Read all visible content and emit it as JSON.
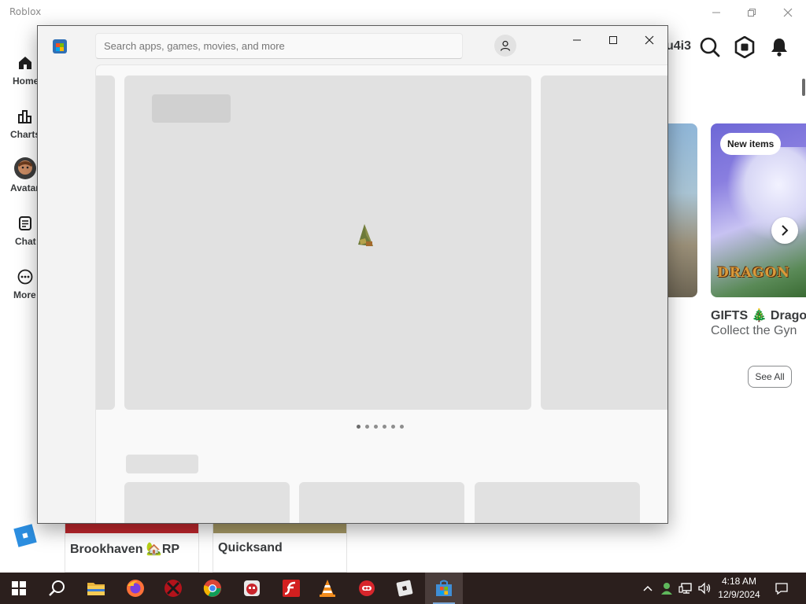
{
  "roblox": {
    "window_title": "Roblox",
    "nav": [
      {
        "label": "Home",
        "icon": "home-icon"
      },
      {
        "label": "Charts",
        "icon": "charts-icon"
      },
      {
        "label": "Avatar",
        "icon": "avatar-icon"
      },
      {
        "label": "Chat",
        "icon": "chat-icon"
      },
      {
        "label": "More",
        "icon": "more-icon"
      }
    ],
    "username_fragment": "u4i3",
    "header_icons": [
      "search-icon",
      "robux-icon",
      "notifications-bell-icon"
    ],
    "featured": {
      "badge": "New items",
      "logo_text": "DRAGON",
      "title": "GIFTS 🎄 Drago",
      "subtitle": "Collect the Gyn",
      "see_all": "See All"
    },
    "tiles": [
      {
        "name": "Brookhaven 🏡RP"
      },
      {
        "name": "Quicksand"
      }
    ]
  },
  "store": {
    "search_placeholder": "Search apps, games, movies, and more",
    "carousel_dot_count": 6,
    "active_dot": 0,
    "accent_color": "#2f6fb6"
  },
  "taskbar": {
    "apps": [
      "windows-start-icon",
      "search-icon",
      "file-explorer-icon",
      "firefox-icon",
      "app-red-icon",
      "chrome-icon",
      "game-app-icon",
      "flash-icon",
      "vlc-icon",
      "red-app-icon",
      "roblox-icon",
      "microsoft-store-icon"
    ],
    "active_app": "microsoft-store-icon",
    "clock": {
      "time": "4:18 AM",
      "date": "12/9/2024"
    }
  }
}
